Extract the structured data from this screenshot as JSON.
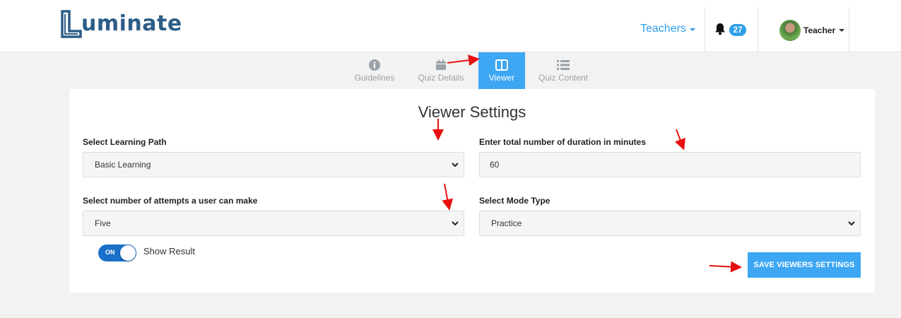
{
  "app": {
    "logo_text": "uminate"
  },
  "header": {
    "teachers_label": "Teachers",
    "notification_count": "27",
    "user_name": "Teacher"
  },
  "tabs": [
    {
      "label": "Guidelines",
      "icon": "info-icon",
      "active": false
    },
    {
      "label": "Quiz Details",
      "icon": "calendar-icon",
      "active": false
    },
    {
      "label": "Viewer",
      "icon": "columns-icon",
      "active": true
    },
    {
      "label": "Quiz Content",
      "icon": "list-icon",
      "active": false
    }
  ],
  "form": {
    "title": "Viewer Settings",
    "learning_path": {
      "label": "Select Learning Path",
      "value": "Basic Learning"
    },
    "duration": {
      "label": "Enter total number of duration in minutes",
      "value": "60"
    },
    "attempts": {
      "label": "Select number of attempts a user can make",
      "value": "Five"
    },
    "mode_type": {
      "label": "Select Mode Type",
      "value": "Practice"
    },
    "show_result": {
      "toggle_text": "ON",
      "label": "Show Result",
      "on": true
    },
    "save_button": "SAVE VIEWERS SETTINGS"
  },
  "colors": {
    "accent": "#3ea7f3",
    "brand": "#2c5d86",
    "toggle": "#1a6fc9",
    "annotation_arrow": "#e8100f"
  }
}
